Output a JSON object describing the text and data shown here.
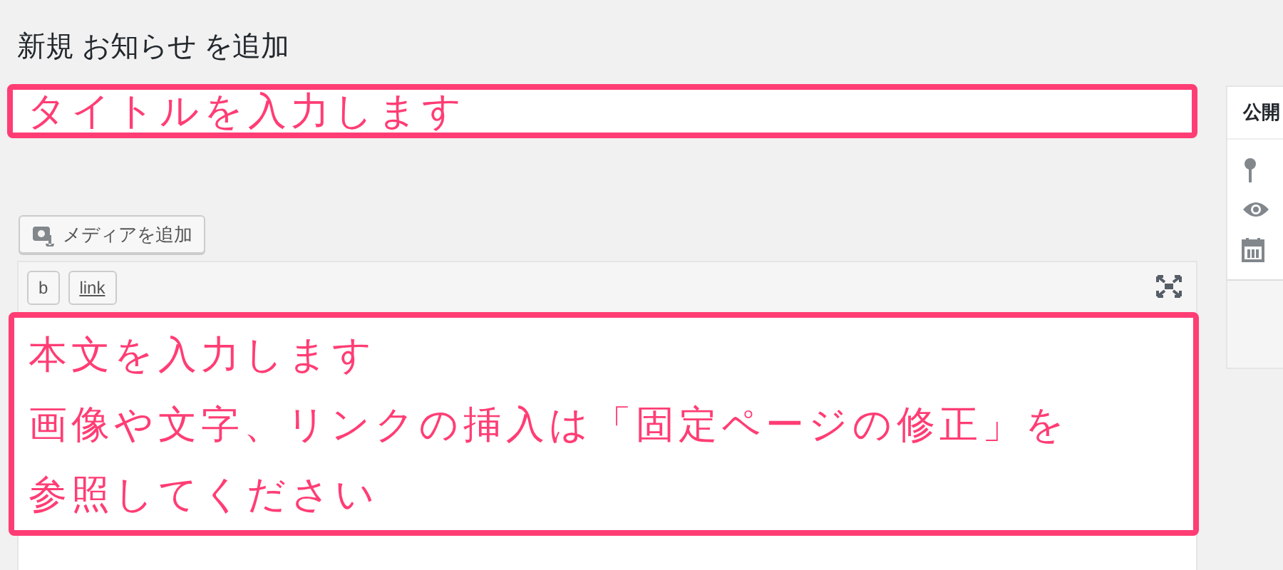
{
  "page_title": "新規 お知らせ を追加",
  "title_field": {
    "value": "タイトルを入力します"
  },
  "media_button": {
    "label": "メディアを追加"
  },
  "toolbar_buttons": [
    {
      "label": "b",
      "kind": "bold"
    },
    {
      "label": "link",
      "kind": "link"
    }
  ],
  "body_lines": [
    "本文を入力します",
    "画像や文字、リンクの挿入は「固定ページの修正」を",
    "参照してください"
  ],
  "publish_panel": {
    "title": "公開"
  }
}
